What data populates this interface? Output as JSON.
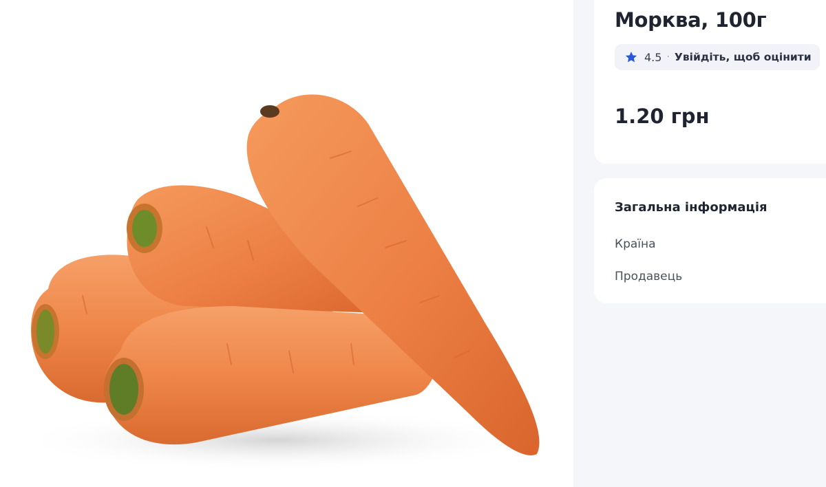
{
  "product": {
    "title": "Морква, 100г",
    "rating": {
      "value": "4.5",
      "separator": "·",
      "login_prompt": "Увійдіть, щоб оцінити",
      "star_color": "#2b58d8"
    },
    "price": "1.20 грн",
    "image": {
      "subject": "carrots-photo",
      "accent_color": "#f08a4b"
    }
  },
  "general_info": {
    "heading": "Загальна інформація",
    "country_label": "Країна",
    "seller_label": "Продавець"
  }
}
